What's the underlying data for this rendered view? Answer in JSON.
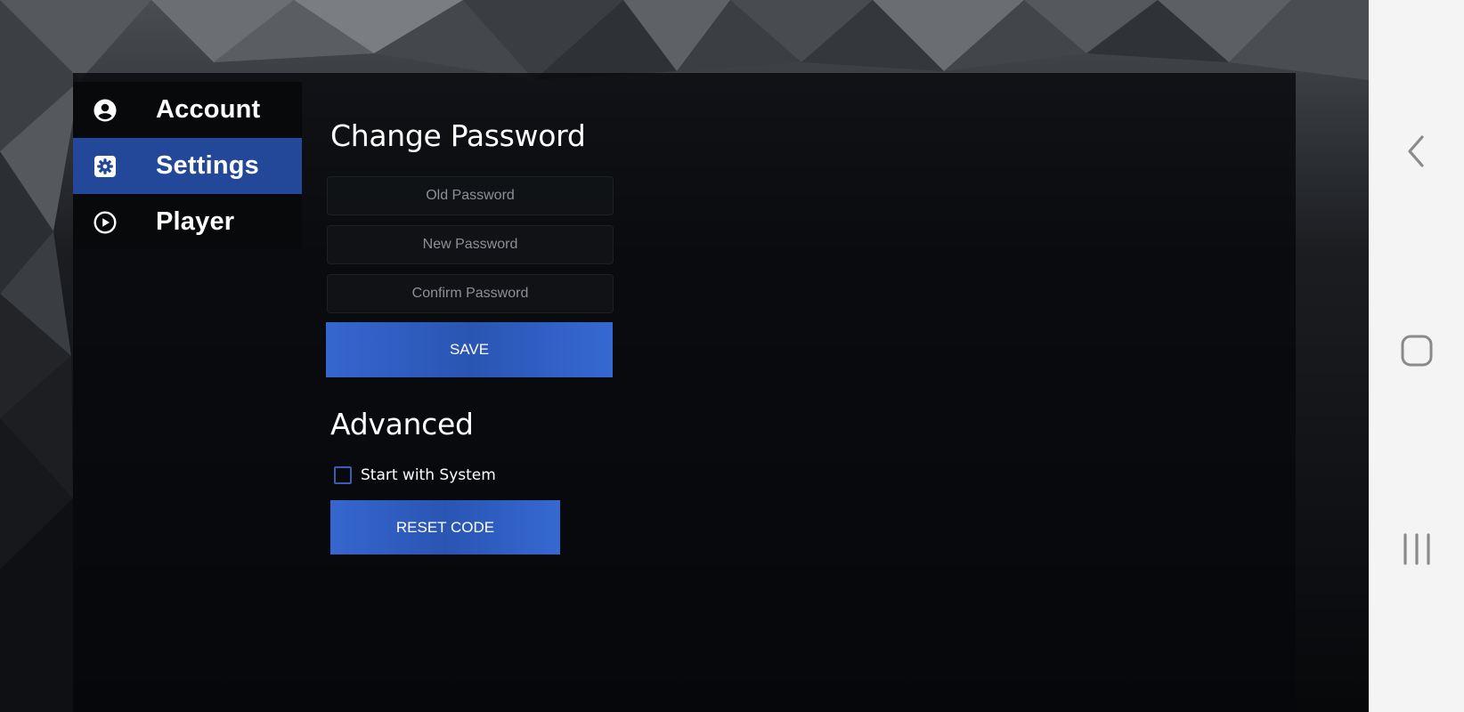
{
  "sidebar": {
    "items": [
      {
        "label": "Account",
        "icon": "account-circle-icon",
        "active": false
      },
      {
        "label": "Settings",
        "icon": "settings-gear-icon",
        "active": true
      },
      {
        "label": "Player",
        "icon": "play-circle-icon",
        "active": false
      }
    ]
  },
  "change_password": {
    "title": "Change Password",
    "old_placeholder": "Old Password",
    "new_placeholder": "New Password",
    "confirm_placeholder": "Confirm Password",
    "old_value": "",
    "new_value": "",
    "confirm_value": "",
    "save_label": "SAVE"
  },
  "advanced": {
    "title": "Advanced",
    "start_with_system_label": "Start with System",
    "start_with_system_checked": false,
    "reset_code_label": "RESET CODE"
  },
  "system_nav": {
    "back_icon": "back-chevron-icon",
    "home_icon": "home-square-icon",
    "recents_icon": "recents-lines-icon"
  },
  "colors": {
    "accent": "#3567cf",
    "active_item": "#23489a",
    "nav_bar": "#f4f4f4",
    "nav_icon": "#8a8a8a"
  }
}
